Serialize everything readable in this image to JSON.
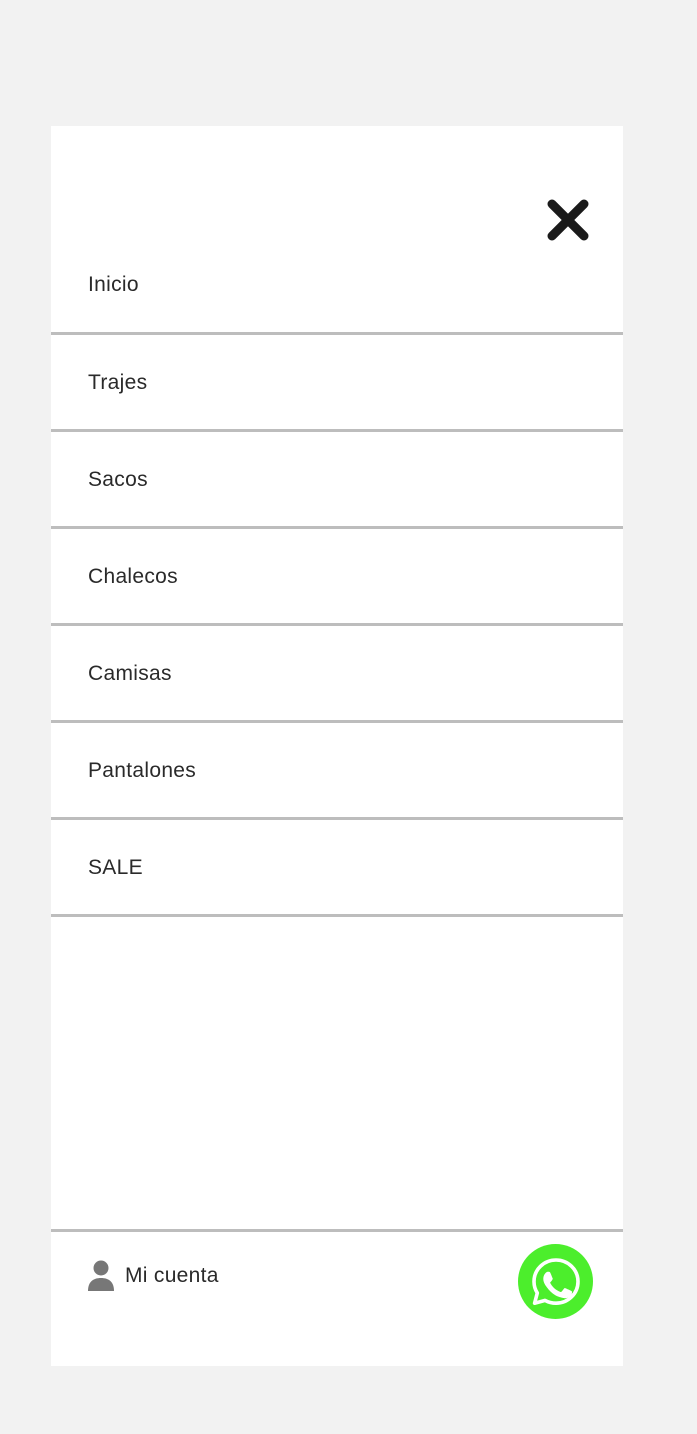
{
  "menu": {
    "close_icon": "close-icon",
    "items": [
      {
        "label": "Inicio"
      },
      {
        "label": "Trajes"
      },
      {
        "label": "Sacos"
      },
      {
        "label": "Chalecos"
      },
      {
        "label": "Camisas"
      },
      {
        "label": "Pantalones"
      },
      {
        "label": "SALE"
      }
    ]
  },
  "footer": {
    "account_label": "Mi cuenta",
    "account_icon": "user-icon",
    "whatsapp_icon": "whatsapp-icon"
  },
  "colors": {
    "background": "#f2f2f2",
    "panel": "#ffffff",
    "divider": "#bdbdbd",
    "text": "#2a2a2a",
    "close": "#1a1a1a",
    "whatsapp": "#4cee2c",
    "user_icon": "#777777"
  }
}
